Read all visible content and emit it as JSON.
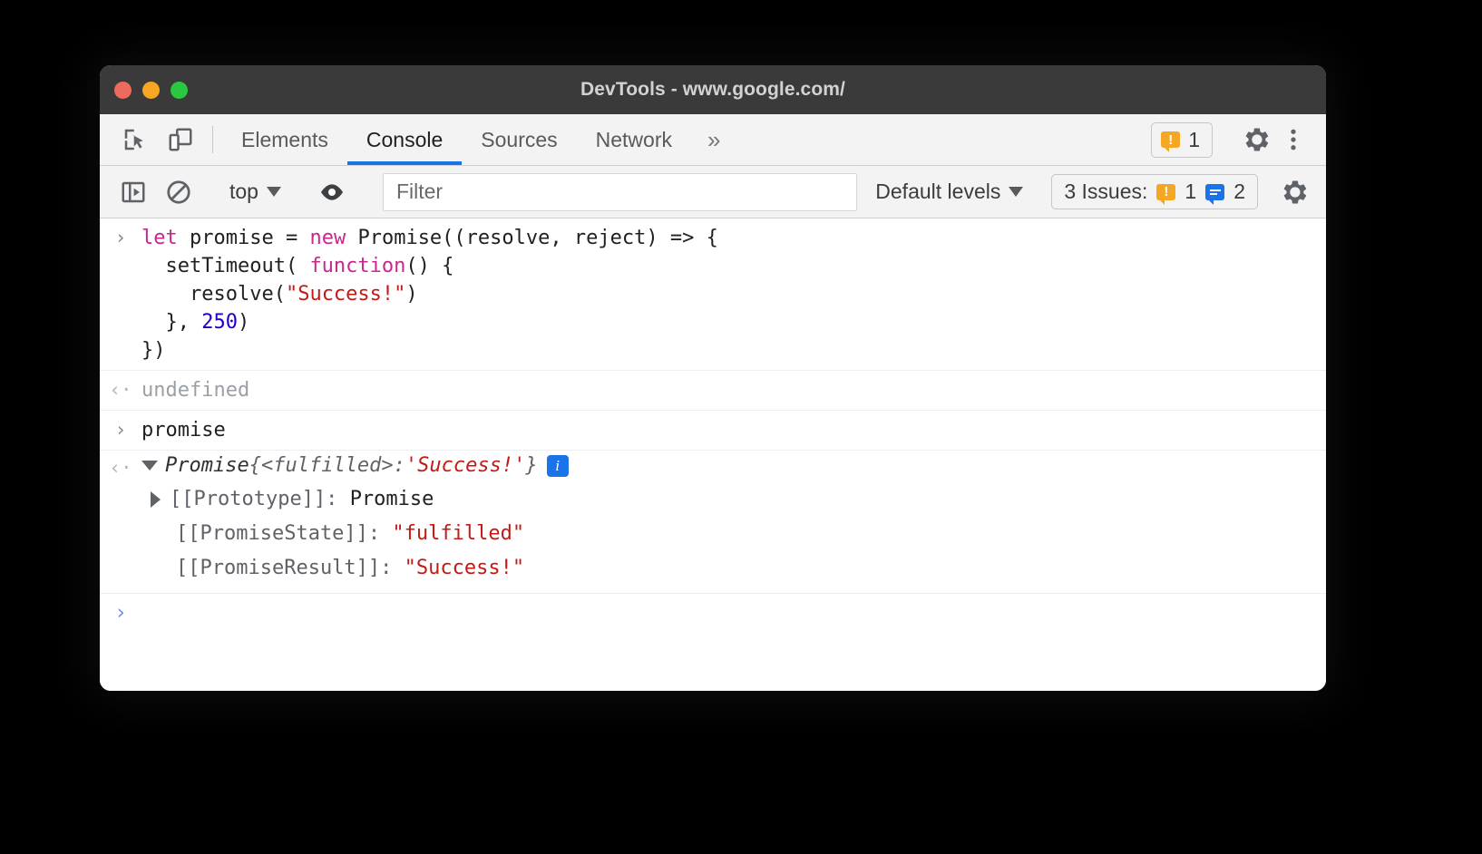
{
  "window": {
    "title": "DevTools - www.google.com/",
    "traffic_lights": [
      "close",
      "minimize",
      "maximize"
    ]
  },
  "tabbar": {
    "icons": [
      {
        "name": "inspect-element-icon",
        "label": "Inspect element"
      },
      {
        "name": "device-toolbar-icon",
        "label": "Toggle device toolbar"
      }
    ],
    "tabs": [
      {
        "label": "Elements",
        "active": false
      },
      {
        "label": "Console",
        "active": true
      },
      {
        "label": "Sources",
        "active": false
      },
      {
        "label": "Network",
        "active": false
      }
    ],
    "more_label": "»",
    "warning_badge": {
      "count": "1",
      "glyph": "!"
    },
    "settings_label": "Settings",
    "menu_label": "Customize and control DevTools"
  },
  "console_toolbar": {
    "sidebar_toggle_label": "Show console sidebar",
    "clear_label": "Clear console",
    "context": "top",
    "eye_label": "Create live expression",
    "filter_placeholder": "Filter",
    "filter_value": "",
    "levels": "Default levels",
    "issues_label": "3 Issues:",
    "issues_warning_count": "1",
    "issues_info_count": "2",
    "settings_label": "Console settings"
  },
  "console": {
    "entries": [
      {
        "type": "input",
        "gutter": "›",
        "lines": [
          [
            {
              "t": "let",
              "c": "kw"
            },
            {
              "t": " promise ",
              "c": "plain"
            },
            {
              "t": "= ",
              "c": "plain"
            },
            {
              "t": "new",
              "c": "kw"
            },
            {
              "t": " Promise((resolve, reject) => {",
              "c": "plain"
            }
          ],
          [
            {
              "t": "  setTimeout( ",
              "c": "plain"
            },
            {
              "t": "function",
              "c": "kw"
            },
            {
              "t": "() {",
              "c": "plain"
            }
          ],
          [
            {
              "t": "    resolve(",
              "c": "plain"
            },
            {
              "t": "\"Success!\"",
              "c": "str"
            },
            {
              "t": ")",
              "c": "plain"
            }
          ],
          [
            {
              "t": "  }, ",
              "c": "plain"
            },
            {
              "t": "250",
              "c": "num"
            },
            {
              "t": ")",
              "c": "plain"
            }
          ],
          [
            {
              "t": "})",
              "c": "plain"
            }
          ]
        ]
      },
      {
        "type": "output",
        "gutter": "‹·",
        "text": "undefined"
      },
      {
        "type": "input",
        "gutter": "›",
        "lines": [
          [
            {
              "t": "promise",
              "c": "plain"
            }
          ]
        ]
      },
      {
        "type": "object",
        "gutter": "‹·",
        "summary_name": "Promise",
        "summary_open": " {",
        "summary_state": "<fulfilled>",
        "summary_colon": ": ",
        "summary_value": "'Success!'",
        "summary_close": "}",
        "info_chip": "i",
        "properties": [
          {
            "expandable": true,
            "key": "[[Prototype]]: ",
            "value": "Promise",
            "value_kind": "plain"
          },
          {
            "expandable": false,
            "key": "[[PromiseState]]: ",
            "value": "\"fulfilled\"",
            "value_kind": "string"
          },
          {
            "expandable": false,
            "key": "[[PromiseResult]]: ",
            "value": "\"Success!\"",
            "value_kind": "string"
          }
        ]
      }
    ],
    "prompt_gutter": "›",
    "prompt_value": ""
  }
}
